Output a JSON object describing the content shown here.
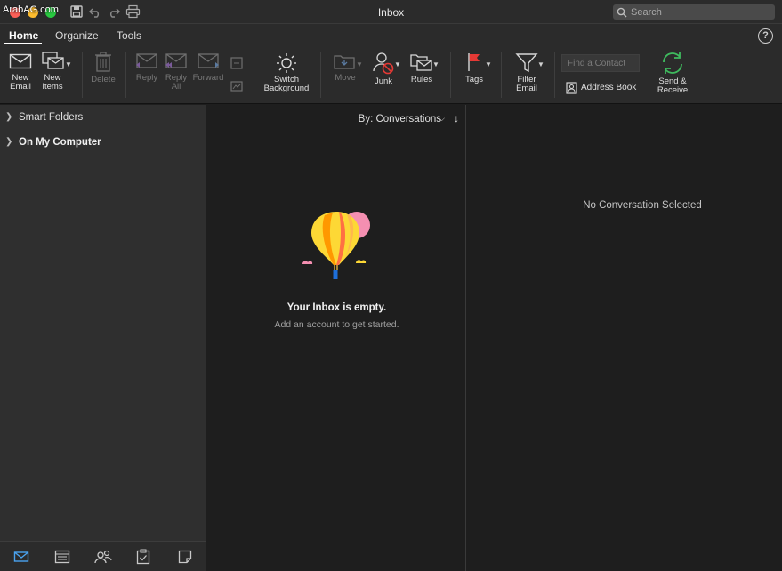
{
  "watermark": "ArabAG.com",
  "window": {
    "title": "Inbox"
  },
  "search": {
    "placeholder": "Search"
  },
  "tabs": [
    {
      "label": "Home",
      "active": true
    },
    {
      "label": "Organize",
      "active": false
    },
    {
      "label": "Tools",
      "active": false
    }
  ],
  "ribbon": {
    "new_email": "New Email",
    "new_items": "New Items",
    "delete": "Delete",
    "reply": "Reply",
    "reply_all": "Reply All",
    "forward": "Forward",
    "switch_background": "Switch Background",
    "move": "Move",
    "junk": "Junk",
    "rules": "Rules",
    "tags": "Tags",
    "filter_email": "Filter Email",
    "find_contact_placeholder": "Find a Contact",
    "address_book": "Address Book",
    "send_receive": "Send & Receive"
  },
  "folders": [
    {
      "label": "Smart Folders",
      "bold": false
    },
    {
      "label": "On My Computer",
      "bold": true
    }
  ],
  "message_list": {
    "sort_label": "By: Conversations",
    "empty_title": "Your Inbox is empty.",
    "empty_subtitle": "Add an account to get started."
  },
  "reading_pane": {
    "placeholder": "No Conversation Selected"
  },
  "bottom_nav": [
    "mail-icon",
    "calendar-icon",
    "people-icon",
    "tasks-icon",
    "notes-icon"
  ],
  "colors": {
    "accent": "#4aa3f0",
    "send_receive": "#3fba5e",
    "flag": "#e53935",
    "background": "#1e1e1e"
  }
}
